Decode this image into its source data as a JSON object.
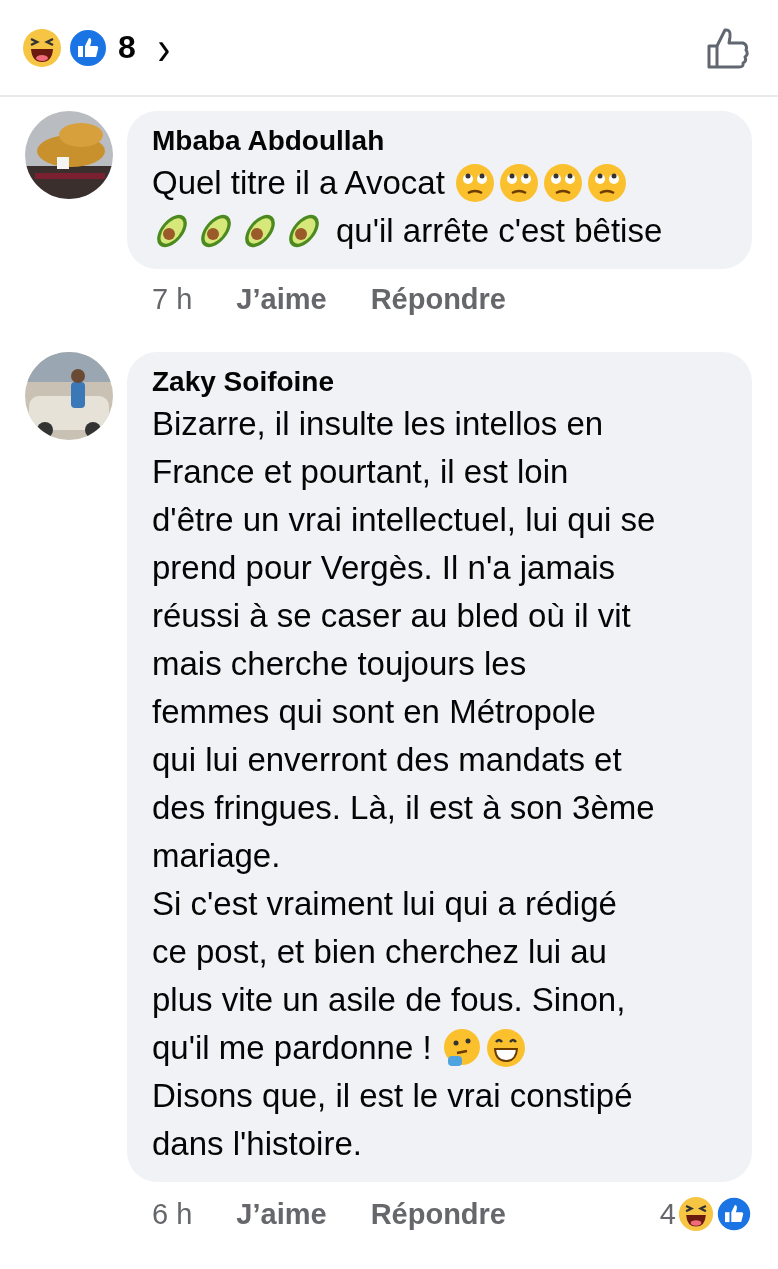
{
  "reactions_bar": {
    "count": "8",
    "chevron": "›"
  },
  "comments": [
    {
      "author": "Mbaba Abdoullah",
      "avatar": {
        "kind": "picture"
      },
      "lines": [
        [
          {
            "kind": "text",
            "text": "Quel titre il a Avocat"
          },
          {
            "kind": "rolleyes"
          },
          {
            "kind": "rolleyes"
          },
          {
            "kind": "rolleyes"
          },
          {
            "kind": "rolleyes"
          }
        ],
        [
          {
            "kind": "avocado"
          },
          {
            "kind": "avocado"
          },
          {
            "kind": "avocado"
          },
          {
            "kind": "avocado"
          },
          {
            "kind": "text",
            "text": "qu'il arrête c'est bêtise"
          }
        ]
      ],
      "time": "7 h",
      "like": "J’aime",
      "reply": "Répondre"
    },
    {
      "author": "Zaky Soifoine",
      "avatar": {
        "kind": "picture"
      },
      "lines": [
        [
          {
            "kind": "text",
            "text": "Bizarre, il insulte les intellos en"
          }
        ],
        [
          {
            "kind": "text",
            "text": "France et pourtant, il est loin"
          }
        ],
        [
          {
            "kind": "text",
            "text": "d'être un vrai intellectuel, lui qui se"
          }
        ],
        [
          {
            "kind": "text",
            "text": "prend pour Vergès. Il n'a jamais"
          }
        ],
        [
          {
            "kind": "text",
            "text": "réussi à se caser au bled où il vit"
          }
        ],
        [
          {
            "kind": "text",
            "text": "mais cherche toujours les"
          }
        ],
        [
          {
            "kind": "text",
            "text": "femmes qui sont en Métropole"
          }
        ],
        [
          {
            "kind": "text",
            "text": "qui lui enverront des mandats et"
          }
        ],
        [
          {
            "kind": "text",
            "text": "des fringues. Là, il est à son 3ème"
          }
        ],
        [
          {
            "kind": "text",
            "text": "mariage."
          }
        ],
        [
          {
            "kind": "text",
            "text": "Si c'est vraiment lui qui a rédigé"
          }
        ],
        [
          {
            "kind": "text",
            "text": "ce post, et bien cherchez lui au"
          }
        ],
        [
          {
            "kind": "text",
            "text": "plus vite un asile de fous. Sinon,"
          }
        ],
        [
          {
            "kind": "text",
            "text": "qu'il me pardonne !"
          },
          {
            "kind": "thinking"
          },
          {
            "kind": "grin"
          }
        ],
        [
          {
            "kind": "text",
            "text": "Disons que, il est le vrai constipé"
          }
        ],
        [
          {
            "kind": "text",
            "text": "dans l'histoire."
          }
        ]
      ],
      "time": "6 h",
      "like": "J’aime",
      "reply": "Répondre",
      "reaction_count": "4"
    }
  ]
}
